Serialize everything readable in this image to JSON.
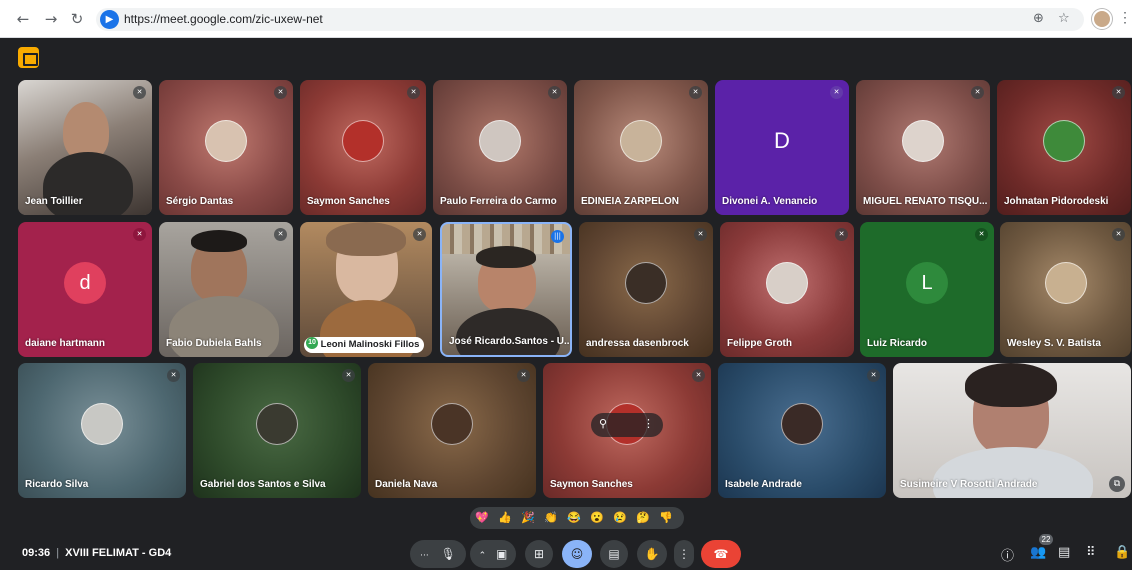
{
  "browser": {
    "url": "https://meet.google.com/zic-uxew-net",
    "icons": [
      "back-icon",
      "forward-icon",
      "reload-icon",
      "zoom-icon",
      "star-icon"
    ]
  },
  "participants": [
    {
      "name": "Jean Toillier",
      "type": "video",
      "bg": "#6b5f59"
    },
    {
      "name": "Sérgio Dantas",
      "type": "avatar",
      "bg": "#8a4a47"
    },
    {
      "name": "Saymon Sanches",
      "type": "avatar",
      "bg": "#8c3a35"
    },
    {
      "name": "Paulo Ferreira do Carmo",
      "type": "avatar",
      "bg": "#7a4c45"
    },
    {
      "name": "EDINEIA ZARPELON",
      "type": "avatar",
      "bg": "#80564a"
    },
    {
      "name": "Divonei A. Venancio",
      "type": "letter",
      "letter": "D",
      "bg": "#5b22a8"
    },
    {
      "name": "MIGUEL RENATO TISQU...",
      "type": "avatar",
      "bg": "#7d4d48"
    },
    {
      "name": "Johnatan Pidorodeski",
      "type": "avatar",
      "bg": "#6e2a28"
    },
    {
      "name": "daiane hartmann",
      "type": "letter",
      "letter": "d",
      "bg": "#a3224c"
    },
    {
      "name": "Fabio Dubiela Bahls",
      "type": "video",
      "bg": "#8a8580"
    },
    {
      "name": "Leoni Malinoski Fillos",
      "type": "video",
      "bg": "#8c6a4a"
    },
    {
      "name": "José Ricardo.Santos - U...",
      "type": "video",
      "bg": "#5a5049"
    },
    {
      "name": "andressa dasenbrock",
      "type": "avatar",
      "bg": "#5e4431"
    },
    {
      "name": "Felippe Groth",
      "type": "avatar",
      "bg": "#8a3a3a"
    },
    {
      "name": "Luiz Ricardo",
      "type": "letter",
      "letter": "L",
      "bg": "#1e6b2a"
    },
    {
      "name": "Wesley S. V. Batista",
      "type": "avatar",
      "bg": "#6e5840"
    },
    {
      "name": "Ricardo Silva",
      "type": "avatar",
      "bg": "#4d6770"
    },
    {
      "name": "Gabriel dos Santos e Silva",
      "type": "avatar",
      "bg": "#2e4a2a"
    },
    {
      "name": "Daniela Nava",
      "type": "avatar",
      "bg": "#5e4530"
    },
    {
      "name": "Saymon Sanches",
      "type": "avatar",
      "bg": "#8c3a35"
    },
    {
      "name": "Isabele Andrade",
      "type": "avatar",
      "bg": "#2a4c6a"
    },
    {
      "name": "Susimeire V Rosotti Andrade",
      "type": "video",
      "bg": "#c8c4c0"
    }
  ],
  "reactions": [
    "💖",
    "👍",
    "🎉",
    "👏",
    "😂",
    "😮",
    "😢",
    "🤔",
    "👎"
  ],
  "meeting": {
    "time": "09:36",
    "separator": "|",
    "title": "XVIII FELIMAT - GD4",
    "participant_count": "22",
    "self_label": "10",
    "speaking": "José Ricardo.Santos - U..."
  },
  "controls": {
    "more_options_label": "···",
    "mic_icon": "mic-icon",
    "camera_icon": "camera-icon",
    "present_icon": "present-icon",
    "reaction_icon": "emoji-icon",
    "captions_icon": "captions-icon",
    "hand_icon": "raise-hand-icon",
    "more_icon": "more-vert-icon",
    "end_call_icon": "end-call-icon"
  },
  "colors": {
    "background": "#202124",
    "end_call": "#ea4335",
    "active_control": "#8ab4f8",
    "speaking": "#1a73e8"
  }
}
